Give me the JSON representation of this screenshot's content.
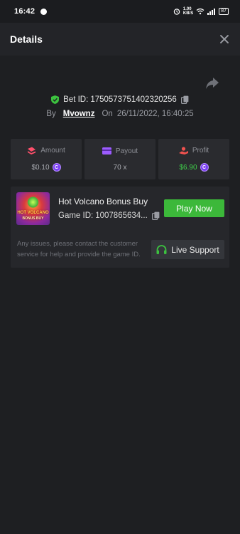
{
  "status_bar": {
    "time": "16:42",
    "network_speed": "1.00\nKB/S",
    "battery": "87"
  },
  "header": {
    "title": "Details"
  },
  "bet": {
    "label": "Bet ID:",
    "id": "1750573751402320256",
    "by_label": "By",
    "username": "Mvownz",
    "on_label": "On",
    "datetime": "26/11/2022, 16:40:25"
  },
  "stats": {
    "amount": {
      "label": "Amount",
      "value": "$0.10"
    },
    "payout": {
      "label": "Payout",
      "value": "70 x"
    },
    "profit": {
      "label": "Profit",
      "value": "$6.90"
    }
  },
  "game": {
    "title": "Hot Volcano Bonus Buy",
    "id_label": "Game ID:",
    "id": "1007865634...",
    "thumbnail_text_1": "HOT VOLCANO",
    "thumbnail_text_2": "BONUS BUY",
    "play_label": "Play Now",
    "notice": "Any issues, please contact the customer service for help and provide the game ID.",
    "support_label": "Live Support"
  },
  "colors": {
    "background": "#1e1f22",
    "card": "#2a2b2f",
    "accent_green": "#3cb83a",
    "profit_green": "#3fd14a",
    "coin_purple": "#7b3ff2",
    "amount_icon_red": "#ff4f6b",
    "payout_icon_purple": "#9c5cff",
    "profit_icon_red": "#f0524f"
  },
  "icons": {
    "share": "share-arrow-icon",
    "verified": "shield-check-icon",
    "copy": "copy-icon",
    "amount": "wager-icon",
    "payout": "card-icon",
    "profit": "profit-icon",
    "coin": "coin-icon",
    "support": "headset-icon"
  }
}
